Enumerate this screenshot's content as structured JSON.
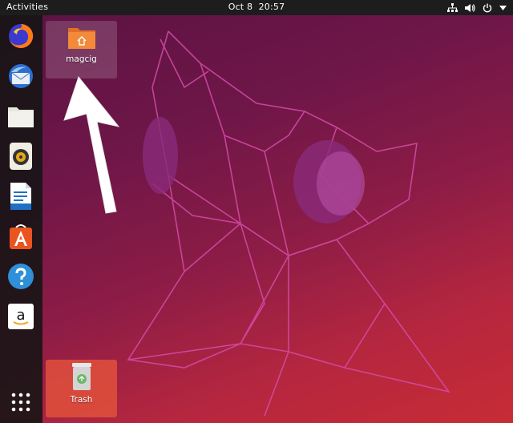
{
  "topbar": {
    "activities_label": "Activities",
    "date": "Oct 8",
    "time": "20:57",
    "tray_icons": [
      "network-icon",
      "volume-icon",
      "power-icon",
      "chevron-down-icon"
    ]
  },
  "dock": {
    "items": [
      {
        "name": "firefox",
        "icon": "firefox-icon"
      },
      {
        "name": "thunderbird",
        "icon": "thunderbird-icon"
      },
      {
        "name": "files",
        "icon": "folder-icon"
      },
      {
        "name": "rhythmbox",
        "icon": "speaker-icon"
      },
      {
        "name": "libreoffice-writer",
        "icon": "document-icon"
      },
      {
        "name": "ubuntu-software",
        "icon": "software-center-icon"
      },
      {
        "name": "help",
        "icon": "help-icon"
      },
      {
        "name": "amazon",
        "icon": "amazon-icon"
      }
    ],
    "show_apps_icon": "grid-icon"
  },
  "desktop": {
    "home_label": "magcig",
    "trash_label": "Trash"
  },
  "colors": {
    "topbar": "#1d1d1d",
    "dock": "#141414",
    "wallpaper_top": "#5b1343",
    "wallpaper_bottom": "#c72c35",
    "folder_orange": "#f28a3a",
    "trash_highlight": "#e1503c"
  }
}
